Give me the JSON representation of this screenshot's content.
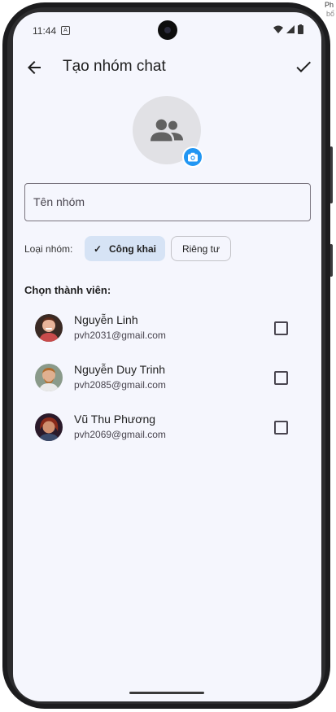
{
  "status_bar": {
    "time": "11:44"
  },
  "app_bar": {
    "title": "Tạo nhóm chat",
    "back_icon": "arrow-back-icon",
    "confirm_icon": "check-icon"
  },
  "group_avatar": {
    "icon": "group-icon",
    "badge_icon": "camera-icon",
    "badge_color": "#2196f3"
  },
  "group_name_field": {
    "placeholder": "Tên nhóm",
    "value": ""
  },
  "group_type": {
    "label": "Loại nhóm:",
    "options": [
      {
        "label": "Công khai",
        "selected": true
      },
      {
        "label": "Riêng tư",
        "selected": false
      }
    ],
    "selected_color": "#d6e3f5"
  },
  "members": {
    "section_title": "Chọn thành viên:",
    "items": [
      {
        "name": "Nguyễn Linh",
        "email": "pvh2031@gmail.com",
        "checked": false
      },
      {
        "name": "Nguyễn Duy Trinh",
        "email": "pvh2085@gmail.com",
        "checked": false
      },
      {
        "name": "Vũ Thu Phương",
        "email": "pvh2069@gmail.com",
        "checked": false
      }
    ]
  },
  "side_text": {
    "line1": "Ph",
    "line2": "bổ"
  }
}
